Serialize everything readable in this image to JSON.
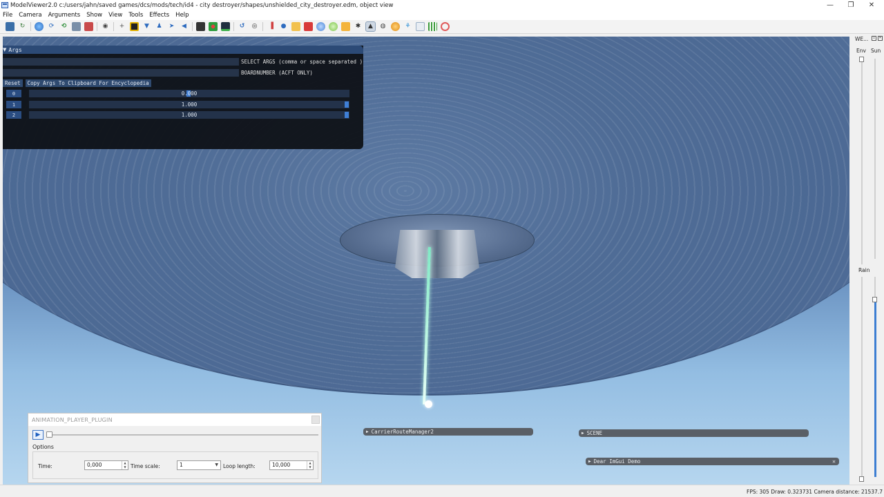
{
  "window": {
    "title": "ModelViewer2.0 c:/users/jahn/saved games/dcs/mods/tech/id4 - city destroyer/shapes/unshielded_city_destroyer.edm, object view",
    "minimize": "—",
    "restore": "❐",
    "close": "✕"
  },
  "menu": [
    "File",
    "Camera",
    "Arguments",
    "Show",
    "View",
    "Tools",
    "Effects",
    "Help"
  ],
  "toolbar": {
    "icons": [
      "save-icon",
      "reload-icon",
      "globe-icon",
      "refresh-icon",
      "refresh-green-icon",
      "image-icon",
      "person-icon",
      "webcam-icon",
      "crosshair-icon",
      "grid-icon",
      "lamp-icon",
      "figure-icon",
      "arrow-icon",
      "speaker-icon",
      "film-icon",
      "dots-icon",
      "monitor-icon",
      "undo-icon",
      "circle-icon",
      "chart-icon",
      "dot-icon",
      "folder-icon",
      "cube-icon",
      "sphere-icon",
      "circle-green-icon",
      "grid-yellow-icon",
      "flame-icon",
      "gauge-icon",
      "ring-icon",
      "molecule-icon",
      "table-icon",
      "grid-green-icon",
      "target-icon"
    ]
  },
  "args_panel": {
    "title": "Args",
    "select_label": "SELECT ARGS (comma or space separated )",
    "board_label": "BOARDNUMBER (ACFT ONLY)",
    "reset_button": "Reset",
    "copy_button": "Copy Args To Clipboard For Encyclopedia",
    "rows": [
      {
        "index": "0",
        "value": "0.000",
        "fraction": 0.0
      },
      {
        "index": "1",
        "value": "1.000",
        "fraction": 1.0
      },
      {
        "index": "2",
        "value": "1.000",
        "fraction": 1.0
      }
    ]
  },
  "animation_player": {
    "title": "ANIMATION_PLAYER_PLUGIN",
    "options_label": "Options",
    "time_label": "Time:",
    "time_value": "0,000",
    "time_scale_label": "Time scale:",
    "time_scale_value": "1",
    "loop_label": "Loop length:",
    "loop_value": "10,000",
    "progress": 0.0
  },
  "imgui_windows": {
    "carrier": "CarrierRouteManager2",
    "scene": "SCENE",
    "demo": "Dear ImGui Demo",
    "demo_close": "✕"
  },
  "weather": {
    "title": "WE...",
    "env_label": "Env",
    "sun_label": "Sun",
    "rain_label": "Rain",
    "sun_level": 0.1,
    "rain_level": 0.9
  },
  "status": {
    "text": "FPS: 305  Draw: 0.323731  Camera distance: 21537.7"
  },
  "colors": {
    "accent": "#3c7ed2",
    "imgui_header": "#2c4a76",
    "beam": "#7fe9c5"
  }
}
